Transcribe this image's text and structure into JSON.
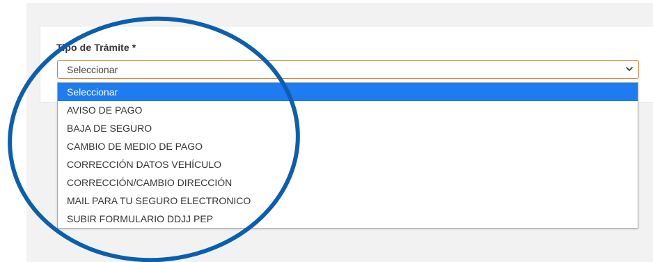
{
  "form": {
    "field_label": "Tipo de Trámite *",
    "select_value": "Seleccionar"
  },
  "dropdown": {
    "options": [
      "Seleccionar",
      "AVISO DE PAGO",
      "BAJA DE SEGURO",
      "CAMBIO DE MEDIO DE PAGO",
      "CORRECCIÓN DATOS VEHÍCULO",
      "CORRECCIÓN/CAMBIO DIRECCIÓN",
      "MAIL PARA TU SEGURO ELECTRONICO",
      "SUBIR FORMULARIO DDJJ PEP"
    ],
    "selected_index": 0
  },
  "colors": {
    "select_border": "#e07b2f",
    "highlight": "#1e7cf0",
    "annotation_circle": "#0b5fae"
  },
  "icons": {
    "select_arrow": "chevron-down-icon"
  }
}
